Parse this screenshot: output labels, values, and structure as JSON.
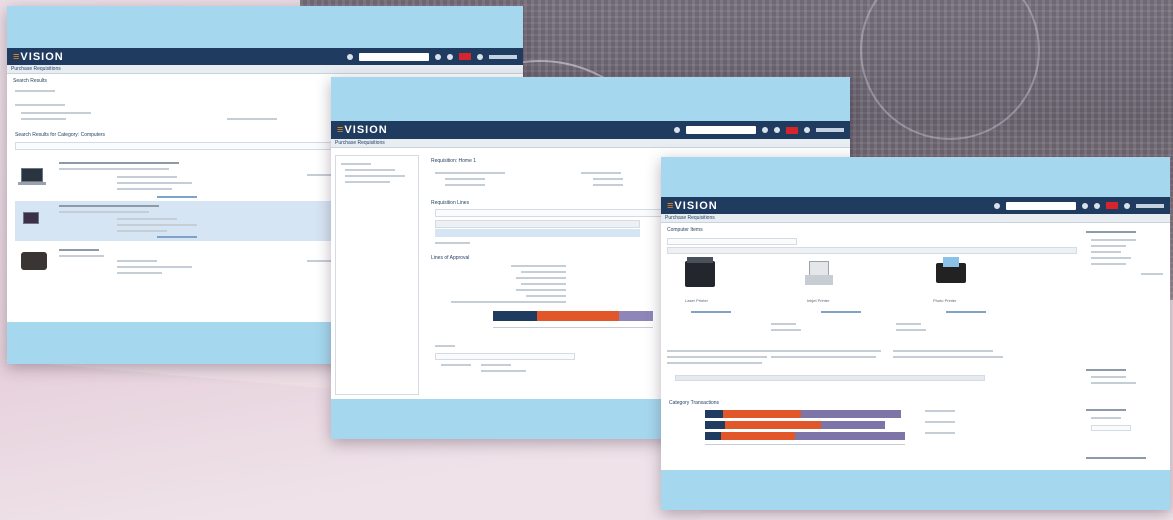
{
  "brand": {
    "logo_text": "VISION",
    "accent": "#f08a1c",
    "header_color": "#1f3b5f",
    "band_color": "#a5d8ef"
  },
  "windows": [
    {
      "id": "search-results",
      "breadcrumb": "Purchase Requisitions",
      "section_title": "Search Results",
      "list_title": "Search Results for Category: Computers"
    },
    {
      "id": "requisition-details",
      "breadcrumb": "Purchase Requisitions",
      "section_title": "Requisition: Home 1",
      "lines_title": "Requisition Lines",
      "approval_title": "Lines of Approval"
    },
    {
      "id": "category-browse",
      "breadcrumb": "Purchase Requisitions",
      "section_title": "Computer Items",
      "products": [
        "Laser Printer",
        "Inkjet Printer",
        "Photo Printer"
      ],
      "chart_title": "Category Transactions"
    }
  ]
}
